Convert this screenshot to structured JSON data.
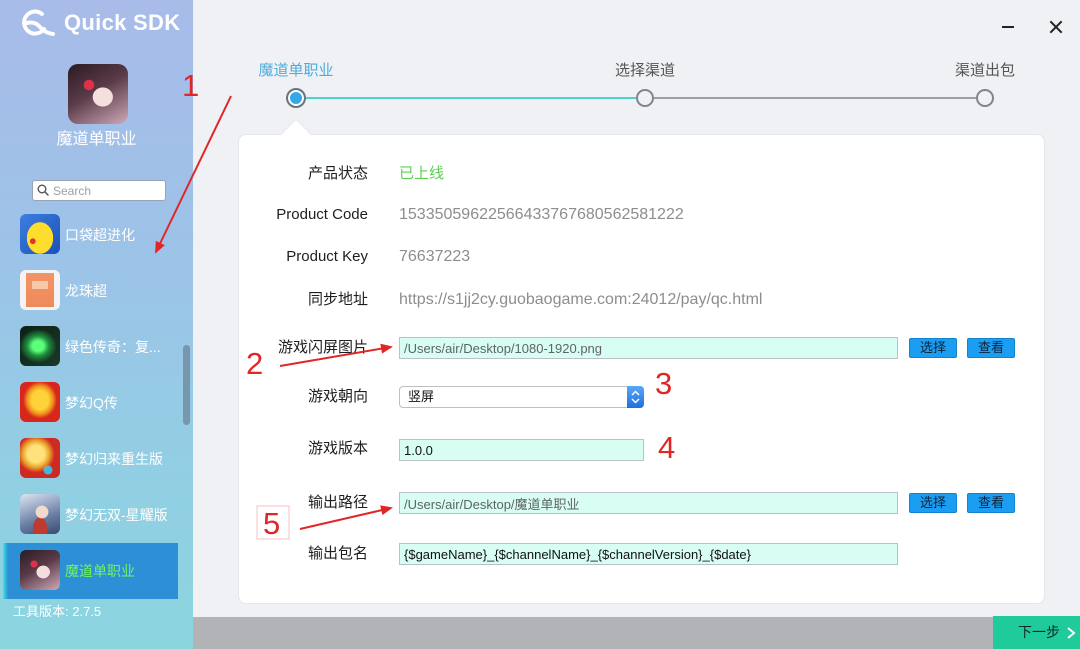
{
  "app": {
    "logo_text": "Quick SDK",
    "logo_icon": "quicksdk-logo-icon"
  },
  "window_controls": {
    "minimize_icon": "minimize-icon",
    "close_icon": "close-icon"
  },
  "sidebar": {
    "current_game": {
      "name": "魔道单职业",
      "icon": "modao-game-icon"
    },
    "search": {
      "placeholder": "Search",
      "icon": "search-icon"
    },
    "games": [
      {
        "name": "口袋超进化",
        "icon": "pikachu-game-icon",
        "selected": false
      },
      {
        "name": "龙珠超",
        "icon": "dragonball-game-icon",
        "selected": false
      },
      {
        "name": "绿色传奇：复...",
        "icon": "legend-game-icon",
        "selected": false
      },
      {
        "name": "梦幻Q传",
        "icon": "menghuan-q-game-icon",
        "selected": false
      },
      {
        "name": "梦幻归来重生版",
        "icon": "menghuan-return-game-icon",
        "selected": false
      },
      {
        "name": "梦幻无双-星耀版",
        "icon": "menghuan-wushuang-game-icon",
        "selected": false
      },
      {
        "name": "魔道单职业",
        "icon": "modao-game-icon",
        "selected": true
      }
    ],
    "version_label": "工具版本: 2.7.5"
  },
  "stepper": {
    "active_step": 1,
    "steps": [
      {
        "label": "魔道单职业"
      },
      {
        "label": "选择渠道"
      },
      {
        "label": "渠道出包"
      }
    ]
  },
  "form": {
    "product_status": {
      "label": "产品状态",
      "value": "已上线"
    },
    "product_code": {
      "label": "Product Code",
      "value": "15335059622566433767680562581222"
    },
    "product_key": {
      "label": "Product Key",
      "value": "76637223"
    },
    "sync_url": {
      "label": "同步地址",
      "value": "https://s1jj2cy.guobaogame.com:24012/pay/qc.html"
    },
    "splash_image": {
      "label": "游戏闪屏图片",
      "value": "/Users/air/Desktop/1080-1920.png",
      "choose_label": "选择",
      "view_label": "查看"
    },
    "orientation": {
      "label": "游戏朝向",
      "value": "竖屏",
      "toggle_icon": "updown-chevron-icon"
    },
    "version": {
      "label": "游戏版本",
      "value": "1.0.0"
    },
    "output_path": {
      "label": "输出路径",
      "value": "/Users/air/Desktop/魔道单职业",
      "choose_label": "选择",
      "view_label": "查看"
    },
    "output_name": {
      "label": "输出包名",
      "value": "{$gameName}_{$channelName}_{$channelVersion}_{$date}"
    }
  },
  "footer": {
    "next_label": "下一步",
    "next_icon": "chevron-right-icon"
  },
  "annotations": [
    "1",
    "2",
    "3",
    "4",
    "5"
  ],
  "colors": {
    "active_step": "#35a8ea",
    "progress_line": "#4fd3c9",
    "status_online": "#5dcf55",
    "input_bg": "#d8fdf2",
    "button_blue": "#1b9df1",
    "next_button": "#1fcb9b",
    "selected_item_bg": "#2d8fd6",
    "selected_item_text": "#72f35d",
    "annotation_red": "#e12626"
  }
}
